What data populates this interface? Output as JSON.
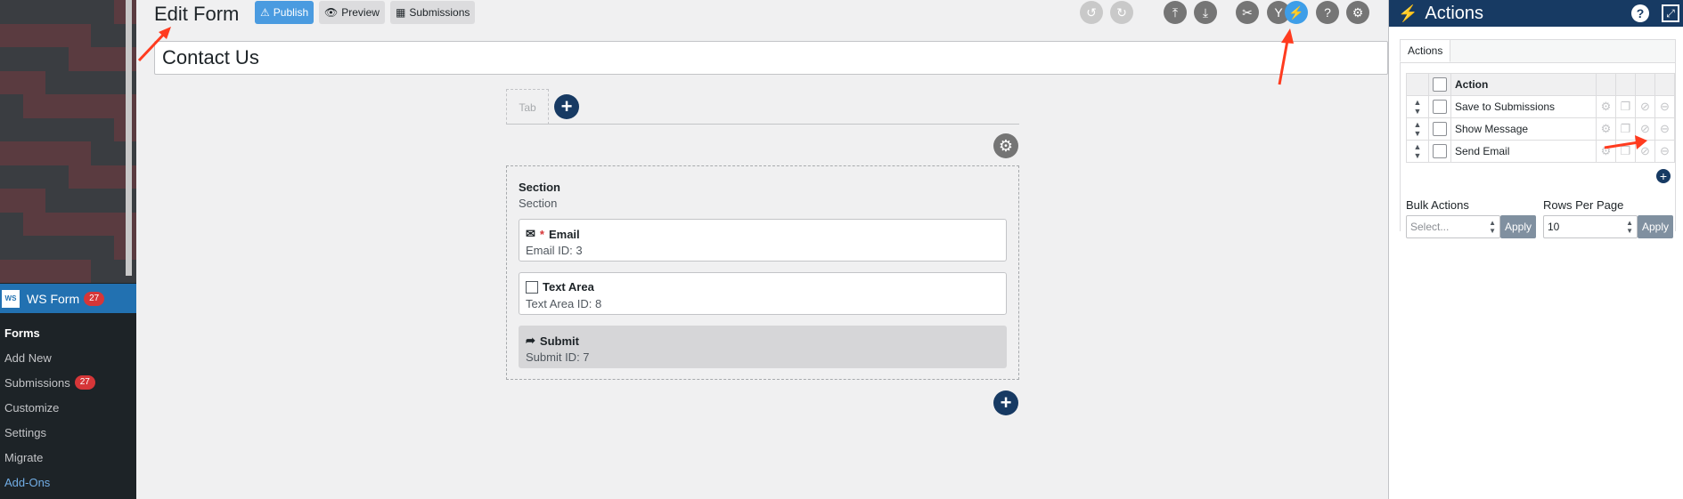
{
  "sidebar": {
    "wsform_label": "WS Form",
    "wsform_logo": "WS",
    "wsform_count": "27",
    "submenu": [
      {
        "label": "Forms",
        "current": true
      },
      {
        "label": "Add New"
      },
      {
        "label": "Submissions",
        "badge": "27"
      },
      {
        "label": "Customize"
      },
      {
        "label": "Settings"
      },
      {
        "label": "Migrate"
      },
      {
        "label": "Add-Ons"
      }
    ]
  },
  "toolbar": {
    "title": "Edit Form",
    "publish_label": "Publish",
    "preview_label": "Preview",
    "submissions_label": "Submissions",
    "icons": [
      "undo-icon",
      "redo-icon",
      "upload-icon",
      "download-icon",
      "tools-icon",
      "conditional-icon",
      "actions-icon",
      "help-icon",
      "settings-icon"
    ]
  },
  "form": {
    "name": "Contact Us",
    "tab_label": "Tab",
    "section": {
      "title": "Section",
      "subtitle": "Section",
      "fields": [
        {
          "label": "Email",
          "required": true,
          "sub": "Email  ID: 3",
          "icon": "envelope-icon"
        },
        {
          "label": "Text Area",
          "sub": "Text Area  ID: 8",
          "icon": "textarea-icon"
        },
        {
          "label": "Submit",
          "sub": "Submit  ID: 7",
          "icon": "share-arrow-icon"
        }
      ]
    }
  },
  "actions_panel": {
    "title": "Actions",
    "tab": "Actions",
    "column_action": "Action",
    "rows": [
      {
        "label": "Save to Submissions"
      },
      {
        "label": "Show Message"
      },
      {
        "label": "Send Email"
      }
    ],
    "bulk_actions_label": "Bulk Actions",
    "bulk_placeholder": "Select...",
    "rows_per_page_label": "Rows Per Page",
    "rows_per_page_value": "10",
    "apply_label": "Apply"
  },
  "colors": {
    "accent": "#173a63",
    "publish": "#4a9be0",
    "admin_bar": "#1d2327",
    "annotation": "#ff3b1f"
  }
}
